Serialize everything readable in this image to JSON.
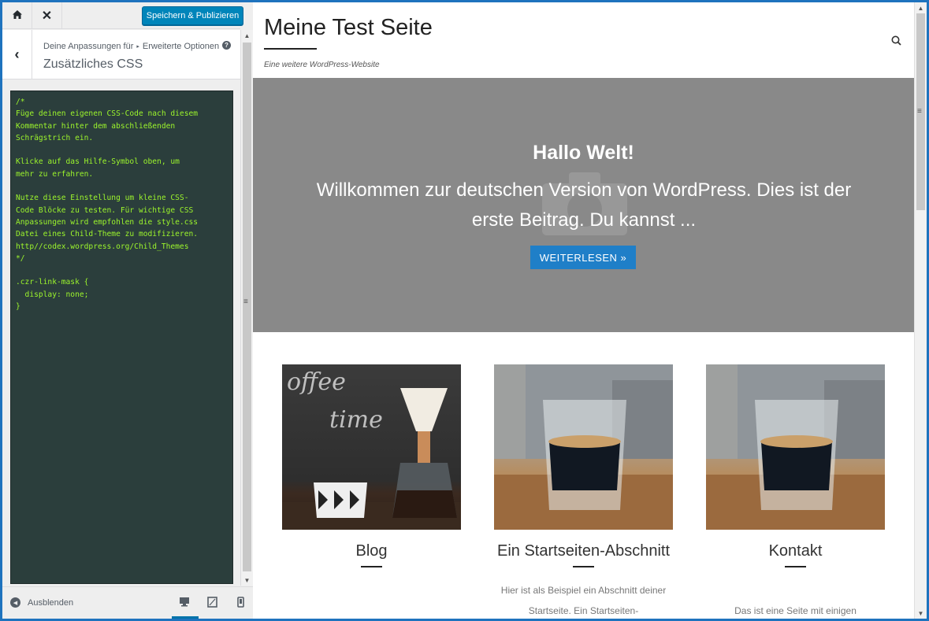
{
  "topbar": {
    "home_icon": "home-icon",
    "close_icon": "close-icon",
    "publish_label": "Speichern & Publizieren",
    "accent": "#0085ba"
  },
  "section": {
    "breadcrumb_root": "Deine Anpassungen für",
    "breadcrumb_parent": "Erweiterte Optionen",
    "title": "Zusätzliches CSS",
    "back_icon": "chevron-left-icon",
    "help_icon": "help-icon"
  },
  "editor": {
    "code": "/*\nFüge deinen eigenen CSS-Code nach diesem\nKommentar hinter dem abschließenden\nSchrägstrich ein.\n\nKlicke auf das Hilfe-Symbol oben, um\nmehr zu erfahren.\n\nNutze diese Einstellung um kleine CSS-\nCode Blöcke zu testen. Für wichtige CSS\nAnpassungen wird empfohlen die style.css\nDatei eines Child-Theme zu modifizieren.\nhttp//codex.wordpress.org/Child_Themes\n*/\n\n.czr-link-mask {\n  display: none;\n}",
    "text_color": "#9cf52c",
    "background": "#2b3e3c"
  },
  "footer": {
    "collapse_label": "Ausblenden",
    "devices": [
      "desktop-icon",
      "tablet-icon",
      "mobile-icon"
    ]
  },
  "site": {
    "title": "Meine Test Seite",
    "tagline": "Eine weitere WordPress-Website",
    "search_icon": "search-icon"
  },
  "hero": {
    "title": "Hallo Welt!",
    "text": "Willkommen zur deutschen Version von WordPress. Dies ist der erste Beitrag. Du kannst ...",
    "button": "WEITERLESEN »",
    "background": "#898989"
  },
  "featured": [
    {
      "title": "Blog",
      "text": ""
    },
    {
      "title": "Ein Startseiten-Abschnitt",
      "text": "Hier ist als Beispiel ein Abschnitt deiner Startseite. Ein Startseiten-"
    },
    {
      "title": "Kontakt",
      "text": "Das ist eine Seite mit einigen"
    }
  ]
}
